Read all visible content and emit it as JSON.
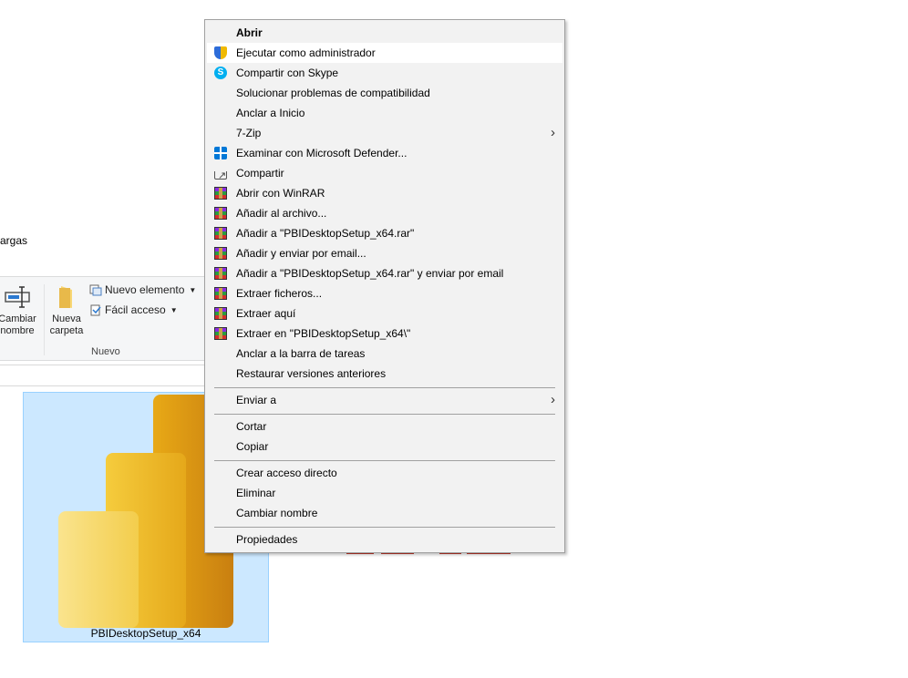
{
  "explorer": {
    "breadcrumb_fragment": "argas",
    "ribbon": {
      "rename_label": "Cambiar nombre",
      "new_folder_label": "Nueva carpeta",
      "new_item_label": "Nuevo elemento",
      "easy_access_label": "Fácil acceso",
      "group_label": "Nuevo"
    },
    "file": {
      "name": "PBIDesktopSetup_x64",
      "icon": "power-bi-icon"
    }
  },
  "context_menu": {
    "items": [
      {
        "label": "Abrir",
        "bold": true
      },
      {
        "label": "Ejecutar como administrador",
        "icon": "uac-shield-icon",
        "hover": true
      },
      {
        "label": "Compartir con Skype",
        "icon": "skype-icon"
      },
      {
        "label": "Solucionar problemas de compatibilidad"
      },
      {
        "label": "Anclar a Inicio"
      },
      {
        "label": "7-Zip",
        "submenu": true
      },
      {
        "label": "Examinar con Microsoft Defender...",
        "icon": "defender-icon"
      },
      {
        "label": "Compartir",
        "icon": "share-icon"
      },
      {
        "label": "Abrir con WinRAR",
        "icon": "winrar-icon"
      },
      {
        "label": "Añadir al archivo...",
        "icon": "winrar-icon"
      },
      {
        "label": "Añadir a \"PBIDesktopSetup_x64.rar\"",
        "icon": "winrar-icon"
      },
      {
        "label": "Añadir y enviar por email...",
        "icon": "winrar-icon"
      },
      {
        "label": "Añadir a \"PBIDesktopSetup_x64.rar\" y enviar por email",
        "icon": "winrar-icon"
      },
      {
        "label": "Extraer ficheros...",
        "icon": "winrar-icon"
      },
      {
        "label": "Extraer aquí",
        "icon": "winrar-icon"
      },
      {
        "label": "Extraer en \"PBIDesktopSetup_x64\\\"",
        "icon": "winrar-icon"
      },
      {
        "label": "Anclar a la barra de tareas"
      },
      {
        "label": "Restaurar versiones anteriores"
      },
      {
        "label": "Enviar a",
        "submenu": true
      },
      {
        "label": "Cortar"
      },
      {
        "label": "Copiar"
      },
      {
        "label": "Crear acceso directo"
      },
      {
        "label": "Eliminar"
      },
      {
        "label": "Cambiar nombre"
      },
      {
        "label": "Propiedades"
      }
    ],
    "submenu_arrow": "›",
    "hover_color": "#ffffff",
    "background_color": "#f2f2f2"
  }
}
